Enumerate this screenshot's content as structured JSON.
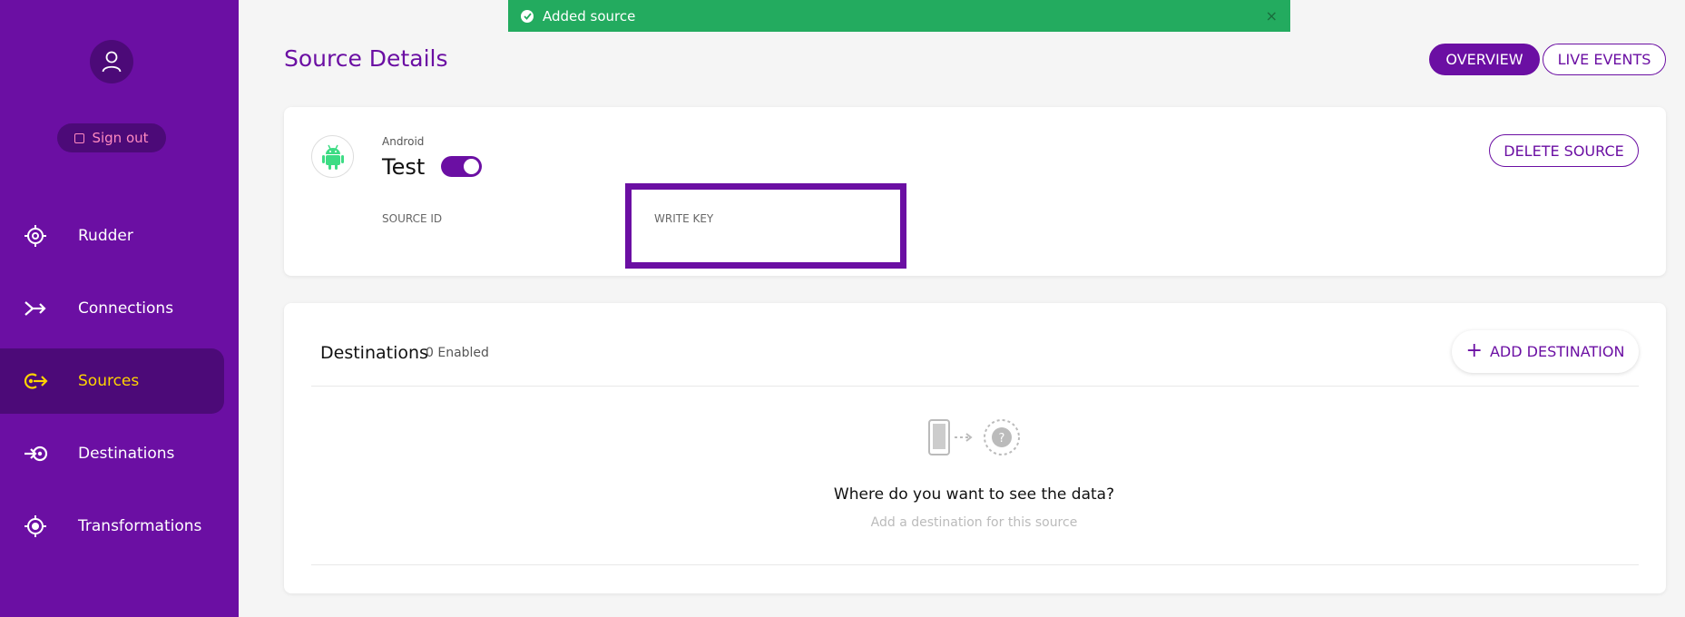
{
  "toast": {
    "message": "Added source",
    "close": "×"
  },
  "sidebar": {
    "signout_label": "Sign out",
    "items": [
      {
        "label": "Rudder",
        "icon": "rudder-icon",
        "active": false
      },
      {
        "label": "Connections",
        "icon": "connections-icon",
        "active": false
      },
      {
        "label": "Sources",
        "icon": "sources-icon",
        "active": true
      },
      {
        "label": "Destinations",
        "icon": "destinations-icon",
        "active": false
      },
      {
        "label": "Transformations",
        "icon": "transformations-icon",
        "active": false
      }
    ]
  },
  "header": {
    "title": "Source Details",
    "tabs": [
      {
        "label": "OVERVIEW",
        "active": true
      },
      {
        "label": "LIVE EVENTS",
        "active": false
      }
    ]
  },
  "source": {
    "type": "Android",
    "name": "Test",
    "enabled": true,
    "source_id_label": "SOURCE ID",
    "write_key_label": "WRITE KEY",
    "delete_label": "DELETE SOURCE"
  },
  "destinations": {
    "title": "Destinations",
    "count": "0 Enabled",
    "add_label": "ADD DESTINATION",
    "empty_title": "Where do you want to see the data?",
    "empty_subtitle": "Add a destination for this source"
  },
  "colors": {
    "brand": "#6b0fa3",
    "sidebar_active": "#4c0a78",
    "active_text": "#ffd400",
    "toast": "#23ab5f",
    "android_green": "#3ddc84"
  }
}
